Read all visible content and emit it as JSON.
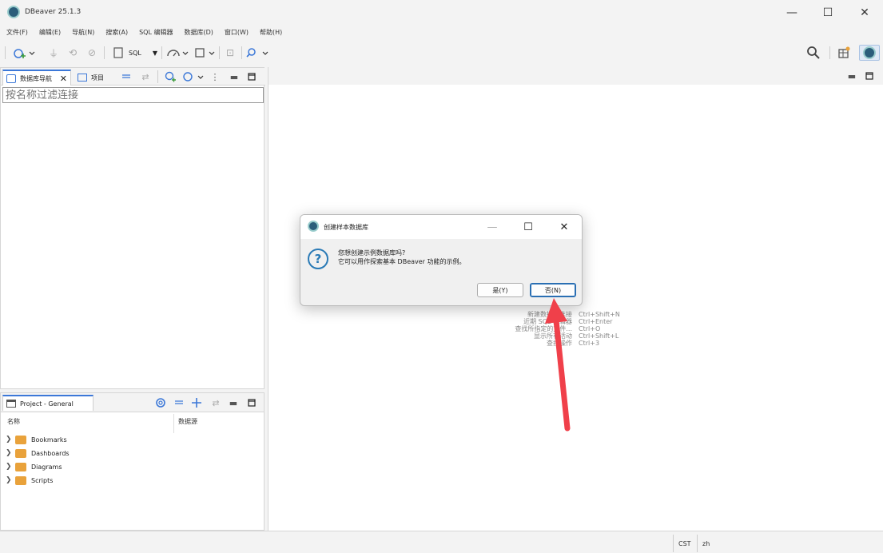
{
  "window": {
    "title": "DBeaver 25.1.3",
    "minimize": "—",
    "maximize": "☐",
    "close": "✕"
  },
  "menu": [
    "文件(F)",
    "编辑(E)",
    "导航(N)",
    "搜索(A)",
    "SQL 编辑器",
    "数据库(D)",
    "窗口(W)",
    "帮助(H)"
  ],
  "toolbar": {
    "sql_label": "SQL"
  },
  "db_navigator": {
    "tab_label": "数据库导航",
    "projects_tab_label": "项目",
    "filter_placeholder": "按名称过滤连接"
  },
  "project_panel": {
    "tab_label": "Project - General",
    "columns": [
      "名称",
      "数据源"
    ],
    "items": [
      "Bookmarks",
      "Dashboards",
      "Diagrams",
      "Scripts"
    ]
  },
  "editor_hints": [
    {
      "action": "新建数据库连接",
      "shortcut": "Ctrl+Shift+N"
    },
    {
      "action": "近期 SQL 编辑器",
      "shortcut": "Ctrl+Enter"
    },
    {
      "action": "查找所指定的文件...",
      "shortcut": "Ctrl+O"
    },
    {
      "action": "显示所有活动",
      "shortcut": "Ctrl+Shift+L"
    },
    {
      "action": "查找操作",
      "shortcut": "Ctrl+3"
    }
  ],
  "dialog": {
    "title": "创建样本数据库",
    "message_line1": "您想创建示例数据库吗?",
    "message_line2": "它可以用作探索基本 DBeaver 功能的示例。",
    "yes_label": "是(Y)",
    "no_label": "否(N)"
  },
  "statusbar": {
    "timezone": "CST",
    "locale": "zh"
  },
  "colors": {
    "accent": "#3c78d8",
    "arrow": "#f0404a",
    "folder": "#e9a23b"
  }
}
